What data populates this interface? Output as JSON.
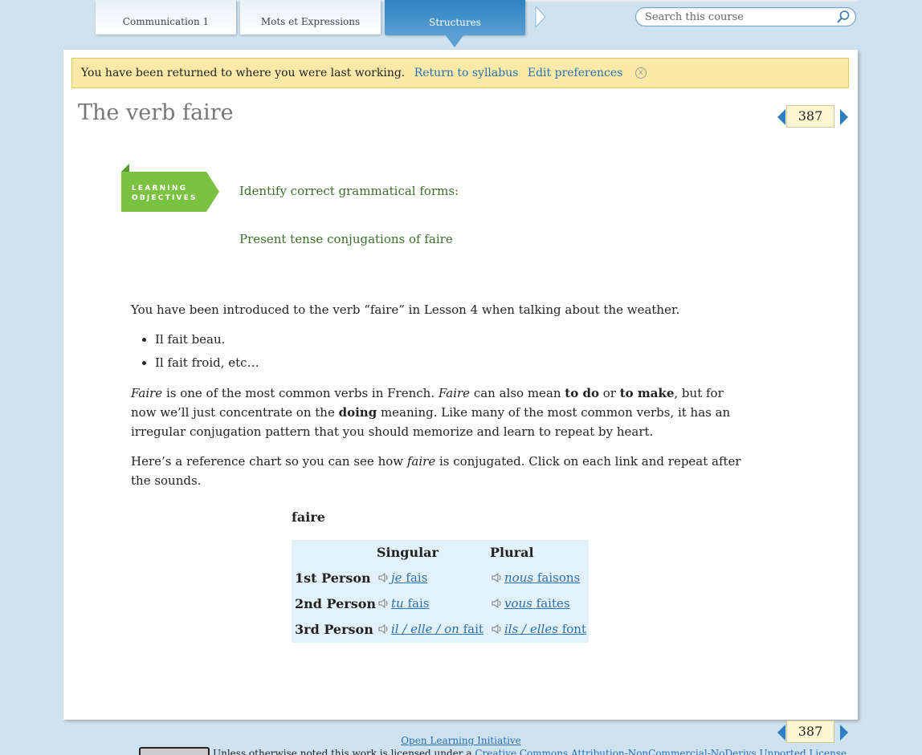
{
  "tabs": [
    {
      "label": "Communication 1",
      "active": false
    },
    {
      "label": "Mots et Expressions",
      "active": false
    },
    {
      "label": "Structures",
      "active": true
    }
  ],
  "search": {
    "placeholder": "Search this course"
  },
  "notice": {
    "message": "You have been returned to where you were last working.",
    "return_link": "Return to syllabus",
    "prefs_link": "Edit preferences",
    "close_glyph": "x"
  },
  "page": {
    "title": "The verb faire",
    "number": "387"
  },
  "learning_objectives": {
    "badge_line1": "LEARNING",
    "badge_line2": "OBJECTIVES",
    "items": [
      "Identify correct grammatical forms:",
      "Present tense conjugations of faire"
    ]
  },
  "content": {
    "intro": "You have been introduced to the verb “faire” in Lesson 4 when talking about the weather.",
    "bullets": [
      "Il fait beau.",
      "Il fait froid, etc…"
    ],
    "p2": {
      "s1_em": "Faire",
      "s1_rest": " is one of the most common verbs in French. ",
      "s2_em": "Faire",
      "s2_a": " can also mean ",
      "s2_b1": "to do",
      "s2_or": " or ",
      "s2_b2": "to make",
      "s2_c": ", but for now we’ll just concentrate on the ",
      "s2_b3": "doing",
      "s2_d": " meaning. Like many of the most common verbs, it has an irregular conjugation pattern that you should memorize and learn to repeat by heart."
    },
    "p3": {
      "a": "Here’s a reference chart so you can see how ",
      "em": "faire",
      "b": " is conjugated. Click on each link and repeat after the sounds."
    }
  },
  "conjugation": {
    "title": "faire",
    "col_singular": "Singular",
    "col_plural": "Plural",
    "rows": [
      {
        "label": "1st Person",
        "singular_pron": "je",
        "singular_verb": "fais",
        "plural_pron": "nous",
        "plural_verb": "faisons"
      },
      {
        "label": "2nd Person",
        "singular_pron": "tu",
        "singular_verb": "fais",
        "plural_pron": "vous",
        "plural_verb": "faites"
      },
      {
        "label": "3rd Person",
        "singular_pron": "il / elle / on",
        "singular_verb": "fait",
        "plural_pron": "ils / elles",
        "plural_verb": "font"
      }
    ]
  },
  "footer": {
    "oli_link": "Open Learning Initiative",
    "license_text": "Unless otherwise noted this work is licensed under a ",
    "license_link": "Creative Commons Attribution-NonCommercial-NoDerivs Unported License"
  },
  "colors": {
    "active_tab": "#2f82c0",
    "notice_bg": "#fbeaa7",
    "objective_green": "#7cc242",
    "link_blue": "#2a6fb0",
    "chart_bg": "#e2f1fa"
  }
}
